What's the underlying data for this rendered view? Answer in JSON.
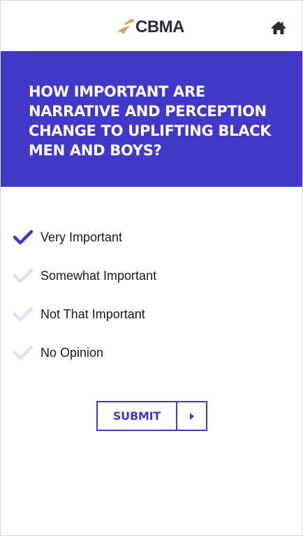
{
  "header": {
    "logo_text": "CBMA",
    "home_icon": "home-icon"
  },
  "question": {
    "text": "HOW IMPORTANT ARE NARRATIVE AND PERCEPTION CHANGE TO UPLIFTING BLACK MEN AND BOYS?"
  },
  "options": [
    {
      "label": "Very Important",
      "selected": true,
      "icon": "check-icon"
    },
    {
      "label": "Somewhat Important",
      "selected": false,
      "icon": "check-icon"
    },
    {
      "label": "Not That Important",
      "selected": false,
      "icon": "check-icon"
    },
    {
      "label": "No Opinion",
      "selected": false,
      "icon": "check-icon"
    }
  ],
  "submit": {
    "label": "SUBMIT",
    "icon": "caret-right-icon"
  },
  "colors": {
    "brand": "#4039c8",
    "check_selected": "#4039c8",
    "check_unselected": "#e1e0f4",
    "logo_gold": "#c9a865",
    "logo_text": "#2a2a3a"
  }
}
